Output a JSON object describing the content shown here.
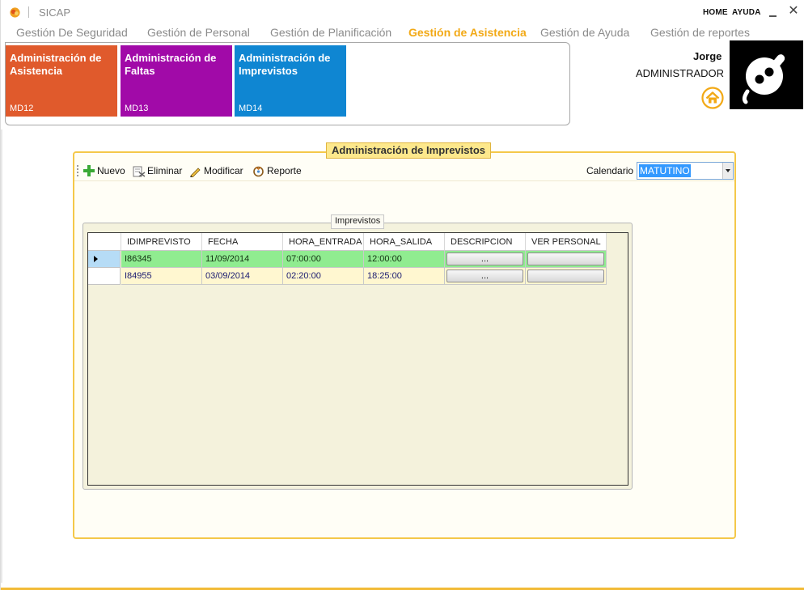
{
  "app": {
    "title": "SICAP"
  },
  "top_links": {
    "home": "HOME",
    "help": "AYUDA"
  },
  "menu": {
    "tabs": [
      {
        "label": "Gestión De Seguridad",
        "active": false
      },
      {
        "label": "Gestión de Personal",
        "active": false
      },
      {
        "label": "Gestión de Planificación",
        "active": false
      },
      {
        "label": "Gestión de Asistencia",
        "active": true
      },
      {
        "label": "Gestión de Ayuda",
        "active": false
      },
      {
        "label": "Gestión de reportes",
        "active": false
      }
    ]
  },
  "tiles": [
    {
      "label": "Administración de Asistencia",
      "code": "MD12",
      "color": "#e05a2c"
    },
    {
      "label": "Administración de Faltas",
      "code": "MD13",
      "color": "#a10aa8"
    },
    {
      "label": "Administración de Imprevistos",
      "code": "MD14",
      "color": "#0f86d2"
    }
  ],
  "user": {
    "name": "Jorge",
    "role": "ADMINISTRADOR"
  },
  "panel": {
    "title": "Administración de Imprevistos",
    "toolbar": {
      "new": "Nuevo",
      "delete": "Eliminar",
      "edit": "Modificar",
      "report": "Reporte"
    },
    "calendar": {
      "label": "Calendario",
      "value": "MATUTINO"
    },
    "group_title": "Imprevistos"
  },
  "grid": {
    "columns": [
      "IDIMPREVISTO",
      "FECHA",
      "HORA_ENTRADA",
      "HORA_SALIDA",
      "DESCRIPCION",
      "VER PERSONAL"
    ],
    "rows": [
      {
        "id": "I86345",
        "fecha": "11/09/2014",
        "entrada": "07:00:00",
        "salida": "12:00:00",
        "descripcion_btn": "...",
        "personal_btn": ""
      },
      {
        "id": "I84955",
        "fecha": "03/09/2014",
        "entrada": "02:20:00",
        "salida": "18:25:00",
        "descripcion_btn": "...",
        "personal_btn": ""
      }
    ]
  },
  "colors": {
    "accent": "#f2a916",
    "row_selected": "#90ec90",
    "row_alt": "#fff7d0",
    "panel_border": "#f4c84a"
  }
}
